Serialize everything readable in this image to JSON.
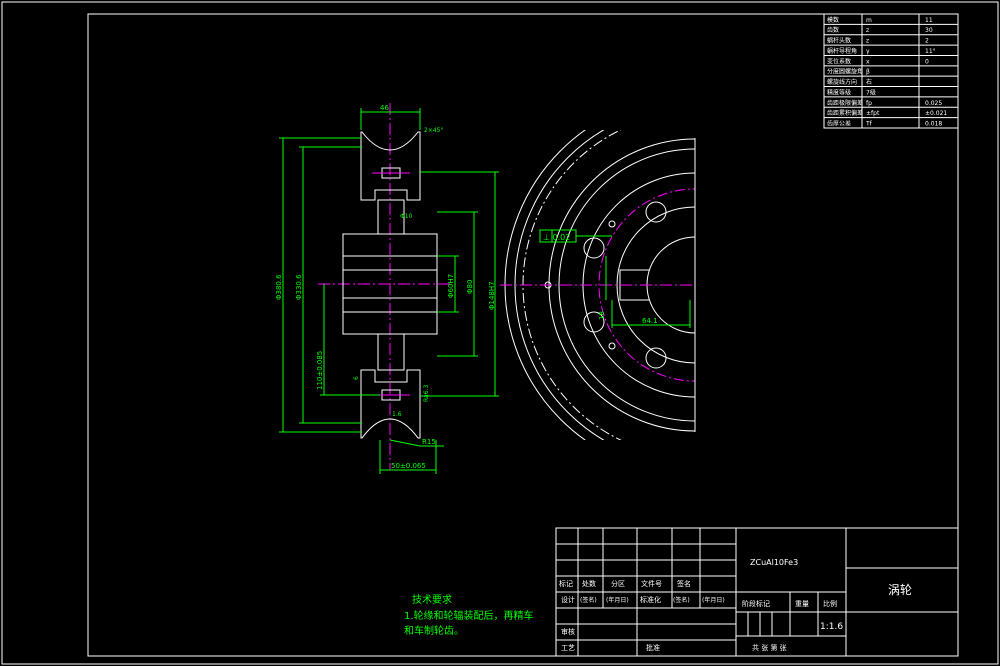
{
  "colors": {
    "background": "#000000",
    "outline": "#ffffff",
    "dimension": "#00ff00",
    "hatch": "#3050ff",
    "centerline": "#ff00ff",
    "note": "#00ff00"
  },
  "params_table": [
    {
      "name": "模数",
      "sym": "m",
      "val": "11"
    },
    {
      "name": "齿数",
      "sym": "z",
      "val": "30"
    },
    {
      "name": "蜗杆头数",
      "sym": "z",
      "val": "2"
    },
    {
      "name": "蜗杆导程角",
      "sym": "γ",
      "val": "11°"
    },
    {
      "name": "变位系数",
      "sym": "x",
      "val": "0"
    },
    {
      "name": "分度圆螺旋角",
      "sym": "β",
      "val": ""
    },
    {
      "name": "螺旋线方向",
      "sym": "右",
      "val": ""
    },
    {
      "name": "精度等级",
      "sym": "7级",
      "val": ""
    },
    {
      "name": "齿距极限偏差",
      "sym": "fp",
      "val": "0.025"
    },
    {
      "name": "齿距累积偏差",
      "sym": "±fpt",
      "val": "±0.021"
    },
    {
      "name": "齿厚公差",
      "sym": "Tf",
      "val": "0.018"
    }
  ],
  "side_view": {
    "dims": {
      "width_top": "46",
      "dia_outer": "Φ380.6",
      "dia_root": "Φ330.6",
      "dia_pitch": "Φ148H7",
      "dia_bore": "Φ60H7",
      "dia_hub": "Φ80",
      "center_dist": "110±0.085",
      "face_width": "50±0.065",
      "radius": "R15",
      "fit_left": "6",
      "chamfer": "Φ10",
      "small_1": "2×45°",
      "small_2": "1.6",
      "small_3": "Ra6.3"
    }
  },
  "front_view": {
    "tol_frame": "⊥ 0.02",
    "key_dim": "64.1",
    "hole_dim": "18"
  },
  "notes": {
    "title": "技术要求",
    "line1": "1.轮缘和轮辐装配后，再精车",
    "line2": "和车制轮齿。"
  },
  "title_block": {
    "material": "ZCuAl10Fe3",
    "part_name": "涡轮",
    "row_labels": [
      "标记",
      "处数",
      "分区",
      "文件号",
      "签名"
    ],
    "design_row": [
      "设计",
      "(签名)",
      "(年月日)",
      "标准化",
      "(签名)",
      "(年月日)"
    ],
    "stage_label": "阶段标记",
    "weight_label": "重量",
    "scale_label": "比例",
    "scale_value": "1:1.6",
    "review_label": "审核",
    "process_label": "工艺",
    "approve_label": "批准",
    "sheets_label": "共   张   第   张"
  }
}
